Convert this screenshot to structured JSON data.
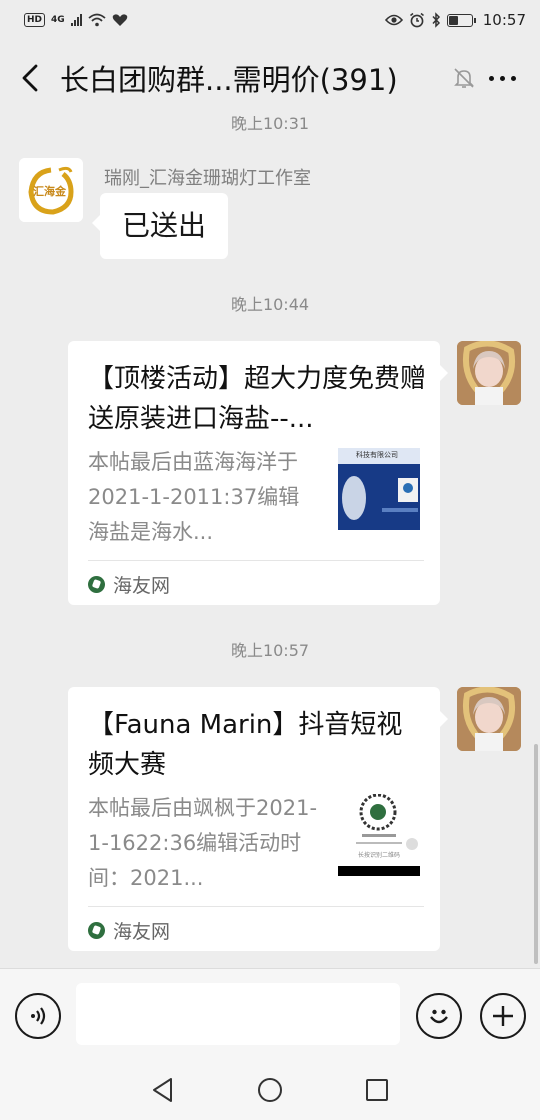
{
  "status_bar": {
    "hd": "HD",
    "network": "4G",
    "time": "10:57",
    "battery_level": 0.45
  },
  "header": {
    "title": "长白团购群...需明价(391)"
  },
  "messages": {
    "ts1": "晚上10:31",
    "msg1": {
      "sender": "瑞刚_汇海金珊瑚灯工作室",
      "avatar_text": "汇海金",
      "text": "已送出"
    },
    "ts2": "晚上10:44",
    "card1": {
      "title": "【顶楼活动】超大力度免费赠送原装进口海盐--...",
      "desc": "本帖最后由蓝海海洋于2021-1-2011:37编辑海盐是海水...",
      "thumb_text": "科技有限公司",
      "source": "海友网"
    },
    "ts3": "晚上10:57",
    "card2": {
      "title": "【Fauna Marin】抖音短视频大赛",
      "desc": "本帖最后由飒枫于2021-1-1622:36编辑活动时间：2021...",
      "thumb_text": "长按识别二维码",
      "source": "海友网"
    }
  },
  "input_bar": {
    "placeholder": ""
  },
  "colors": {
    "background": "#ededed",
    "bubble": "#ffffff",
    "timestamp": "#8a8a8a",
    "source_icon": "#2f6f3f"
  },
  "icons": [
    "back-arrow-icon",
    "mute-bell-icon",
    "more-icon",
    "voice-icon",
    "emoji-icon",
    "add-icon",
    "nav-back-icon",
    "nav-home-icon",
    "nav-recent-icon"
  ]
}
